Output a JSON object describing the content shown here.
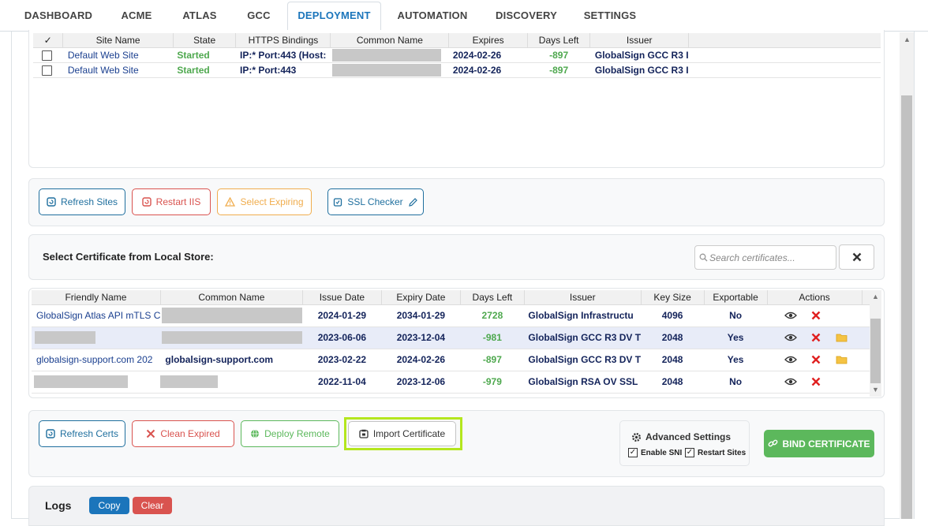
{
  "tabs": [
    {
      "label": "DASHBOARD"
    },
    {
      "label": "ACME"
    },
    {
      "label": "ATLAS"
    },
    {
      "label": "GCC"
    },
    {
      "label": "DEPLOYMENT"
    },
    {
      "label": "AUTOMATION"
    },
    {
      "label": "DISCOVERY"
    },
    {
      "label": "SETTINGS"
    }
  ],
  "active_tab": "DEPLOYMENT",
  "sites": {
    "headers": {
      "check": "✓",
      "site_name": "Site Name",
      "state": "State",
      "https_bindings": "HTTPS Bindings",
      "common_name": "Common Name",
      "expires": "Expires",
      "days_left": "Days Left",
      "issuer": "Issuer"
    },
    "rows": [
      {
        "site_name": "Default Web Site",
        "state": "Started",
        "https_bindings": "IP:* Port:443 (Host:",
        "expires": "2024-02-26",
        "days_left": "-897",
        "issuer": "GlobalSign GCC R3 I"
      },
      {
        "site_name": "Default Web Site",
        "state": "Started",
        "https_bindings": "IP:* Port:443",
        "expires": "2024-02-26",
        "days_left": "-897",
        "issuer": "GlobalSign GCC R3 I"
      }
    ]
  },
  "site_actions": {
    "refresh_sites": "Refresh Sites",
    "restart_iis": "Restart IIS",
    "select_expiring": "Select Expiring",
    "ssl_checker": "SSL Checker"
  },
  "local_store": {
    "heading": "Select Certificate from Local Store:",
    "search_placeholder": "Search certificates..."
  },
  "certs": {
    "headers": {
      "friendly_name": "Friendly Name",
      "common_name": "Common Name",
      "issue_date": "Issue Date",
      "expiry_date": "Expiry Date",
      "days_left": "Days Left",
      "issuer": "Issuer",
      "key_size": "Key Size",
      "exportable": "Exportable",
      "actions": "Actions"
    },
    "rows": [
      {
        "friendly_name": "GlobalSign Atlas API mTLS C",
        "common_name": "",
        "issue_date": "2024-01-29",
        "expiry_date": "2034-01-29",
        "days_left": "2728",
        "issuer": "GlobalSign Infrastructu",
        "key_size": "4096",
        "exportable": "No"
      },
      {
        "friendly_name": "",
        "common_name": "",
        "issue_date": "2023-06-06",
        "expiry_date": "2023-12-04",
        "days_left": "-981",
        "issuer": "GlobalSign GCC R3 DV T",
        "key_size": "2048",
        "exportable": "Yes"
      },
      {
        "friendly_name": "globalsign-support.com 202",
        "common_name": "globalsign-support.com",
        "issue_date": "2023-02-22",
        "expiry_date": "2024-02-26",
        "days_left": "-897",
        "issuer": "GlobalSign GCC R3 DV T",
        "key_size": "2048",
        "exportable": "Yes"
      },
      {
        "friendly_name": "",
        "common_name": "",
        "issue_date": "2022-11-04",
        "expiry_date": "2023-12-06",
        "days_left": "-979",
        "issuer": "GlobalSign RSA OV SSL",
        "key_size": "2048",
        "exportable": "No"
      }
    ]
  },
  "cert_actions": {
    "refresh_certs": "Refresh Certs",
    "clean_expired": "Clean Expired",
    "deploy_remote": "Deploy Remote",
    "import_certificate": "Import Certificate"
  },
  "advanced": {
    "title": "Advanced Settings",
    "enable_sni": "Enable SNI",
    "restart_sites": "Restart Sites"
  },
  "bind_certificate": "BIND CERTIFICATE",
  "logs": {
    "title": "Logs",
    "copy": "Copy",
    "clear": "Clear"
  },
  "colors": {
    "accent_blue": "#1b75bb",
    "success_green": "#5cb85c",
    "danger_red": "#d9534f",
    "warning_orange": "#f0ad4e",
    "highlight_lime": "#b4e61e"
  }
}
